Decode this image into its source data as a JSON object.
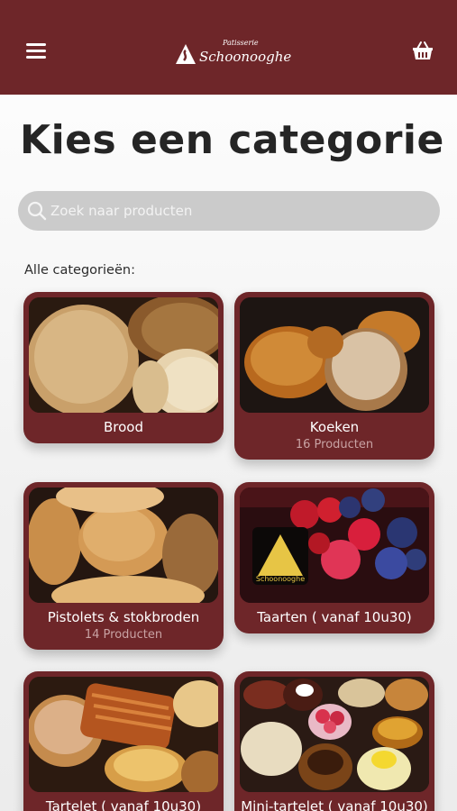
{
  "header": {
    "logo_sub": "Patisserie",
    "logo_main": "Schoonooghe",
    "menu_icon": "hamburger-menu-icon",
    "cart_icon": "basket-icon",
    "brand_color": "#6e2629"
  },
  "page": {
    "title": "Kies een categorie"
  },
  "search": {
    "placeholder": "Zoek naar producten",
    "value": ""
  },
  "section": {
    "label": "Alle categorieën:"
  },
  "categories": [
    {
      "name": "Brood",
      "count": ""
    },
    {
      "name": "Koeken",
      "count": "16 Producten"
    },
    {
      "name": "Pistolets & stokbroden",
      "count": "14 Producten"
    },
    {
      "name": "Taarten ( vanaf 10u30)",
      "count": "",
      "image_text": "Schoonooghe"
    },
    {
      "name": "Tartelet ( vanaf 10u30)",
      "count": ""
    },
    {
      "name": "Mini-tartelet ( vanaf 10u30)",
      "count": ""
    }
  ]
}
